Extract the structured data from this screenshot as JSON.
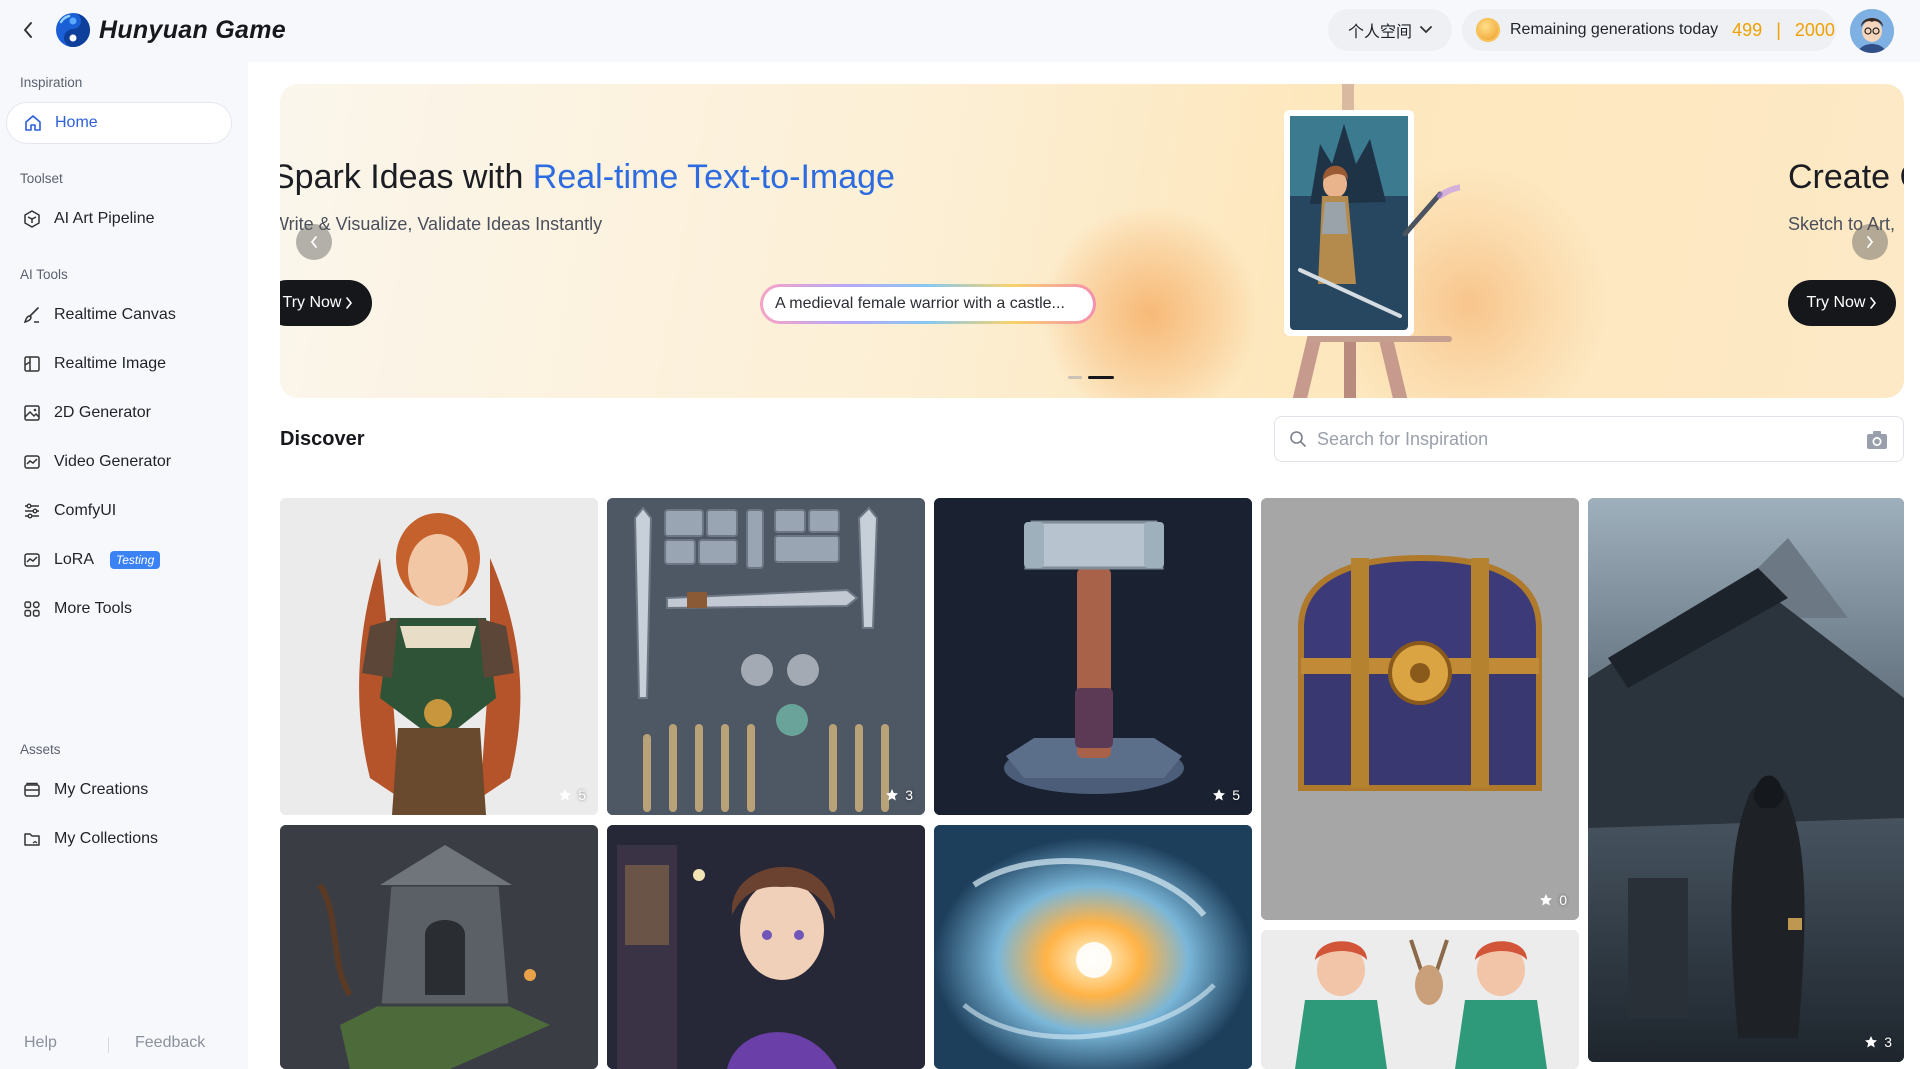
{
  "header": {
    "brand": "Hunyuan Game",
    "space_label": "个人空间",
    "quota_label": "Remaining generations today",
    "quota_used": "499",
    "quota_separator": "|",
    "quota_total": "2000"
  },
  "sidebar": {
    "sections": [
      {
        "title": "Inspiration"
      },
      {
        "title": "Toolset"
      },
      {
        "title": "AI Tools"
      },
      {
        "title": "Assets"
      }
    ],
    "items": [
      {
        "label": "Home",
        "icon": "home-icon",
        "active": true
      },
      {
        "label": "AI Art Pipeline",
        "icon": "pipeline-icon"
      },
      {
        "label": "Realtime Canvas",
        "icon": "brush-icon"
      },
      {
        "label": "Realtime Image",
        "icon": "image-realtime-icon"
      },
      {
        "label": "2D Generator",
        "icon": "image-2d-icon"
      },
      {
        "label": "Video Generator",
        "icon": "video-icon"
      },
      {
        "label": "ComfyUI",
        "icon": "sliders-icon"
      },
      {
        "label": "LoRA",
        "icon": "lora-icon",
        "badge": "Testing"
      },
      {
        "label": "More Tools",
        "icon": "grid-icon"
      },
      {
        "label": "My Creations",
        "icon": "creations-icon"
      },
      {
        "label": "My Collections",
        "icon": "collections-icon"
      }
    ],
    "footer": {
      "help": "Help",
      "feedback": "Feedback"
    }
  },
  "banner": {
    "slide1": {
      "title_plain": "Spark Ideas with ",
      "title_accent": "Real-time Text-to-Image",
      "subtitle": "Write & Visualize, Validate Ideas Instantly",
      "cta": "Try Now",
      "prompt": "A medieval female warrior with a castle..."
    },
    "slide2": {
      "title": "Create C",
      "subtitle": "Sketch to Art,",
      "cta": "Try Now"
    },
    "slides_count": 2,
    "active_slide": 2
  },
  "discover": {
    "title": "Discover",
    "search_placeholder": "Search for Inspiration",
    "cards": [
      {
        "subject": "red-haired female warrior",
        "stars": "5"
      },
      {
        "subject": "weapon sprite sheet",
        "stars": "3"
      },
      {
        "subject": "stone hammer",
        "stars": "5"
      },
      {
        "subject": "treasure chest",
        "stars": "0"
      },
      {
        "subject": "hooded assassin in ruins",
        "stars": "3"
      },
      {
        "subject": "ruined shrine",
        "stars": ""
      },
      {
        "subject": "anime boy in purple hoodie",
        "stars": ""
      },
      {
        "subject": "swirling fire vortex",
        "stars": ""
      },
      {
        "subject": "green-coat characters",
        "stars": ""
      }
    ]
  },
  "colors": {
    "accent": "#2d6be0",
    "quota": "#f0a000",
    "badge": "#3b82f6",
    "cta": "#15171b"
  }
}
